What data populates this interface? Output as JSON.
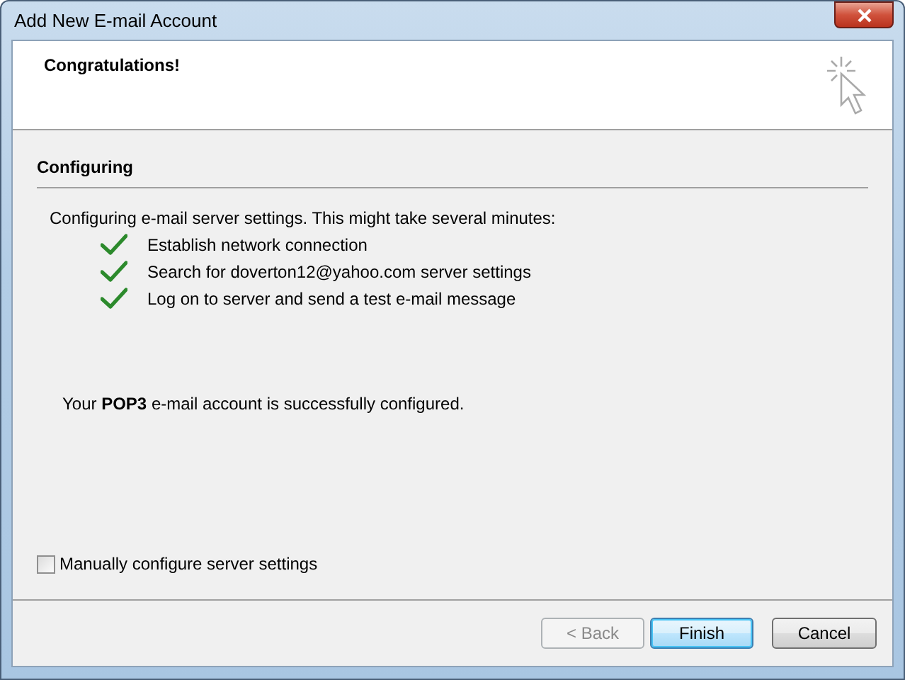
{
  "window": {
    "title": "Add New E-mail Account"
  },
  "header": {
    "title": "Congratulations!"
  },
  "section": {
    "title": "Configuring",
    "intro": "Configuring e-mail server settings. This might take several minutes:",
    "steps": [
      {
        "label": "Establish network connection",
        "done": true
      },
      {
        "label": "Search for doverton12@yahoo.com server settings",
        "done": true
      },
      {
        "label": "Log on to server and send a test e-mail message",
        "done": true
      }
    ],
    "result": "Your **POP3** e-mail account is successfully configured."
  },
  "manual_config": {
    "label": "Manually configure server settings",
    "checked": false
  },
  "buttons": [
    {
      "label": "< Back",
      "disabled": true,
      "default": false
    },
    {
      "label": "Finish",
      "disabled": false,
      "default": true
    },
    {
      "label": "Cancel",
      "disabled": false,
      "default": false
    }
  ]
}
